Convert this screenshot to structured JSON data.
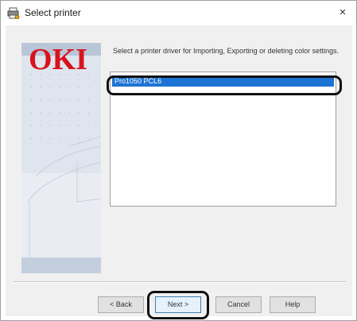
{
  "window": {
    "title": "Select printer",
    "close_symbol": "×"
  },
  "side_panel": {
    "logo_text": "OKI",
    "logo_color": "#d7141e"
  },
  "content": {
    "instruction": "Select a printer driver for Importing, Exporting or deleting color settings.",
    "list": {
      "items": [
        "Pro1050 PCL6"
      ],
      "selected_index": 0
    }
  },
  "buttons": {
    "back": "< Back",
    "next": "Next >",
    "cancel": "Cancel",
    "help": "Help"
  },
  "colors": {
    "selection": "#1e74d4",
    "highlight_ring": "#111111"
  },
  "icons": {
    "title": "printer-settings-icon",
    "close": "close-icon"
  }
}
